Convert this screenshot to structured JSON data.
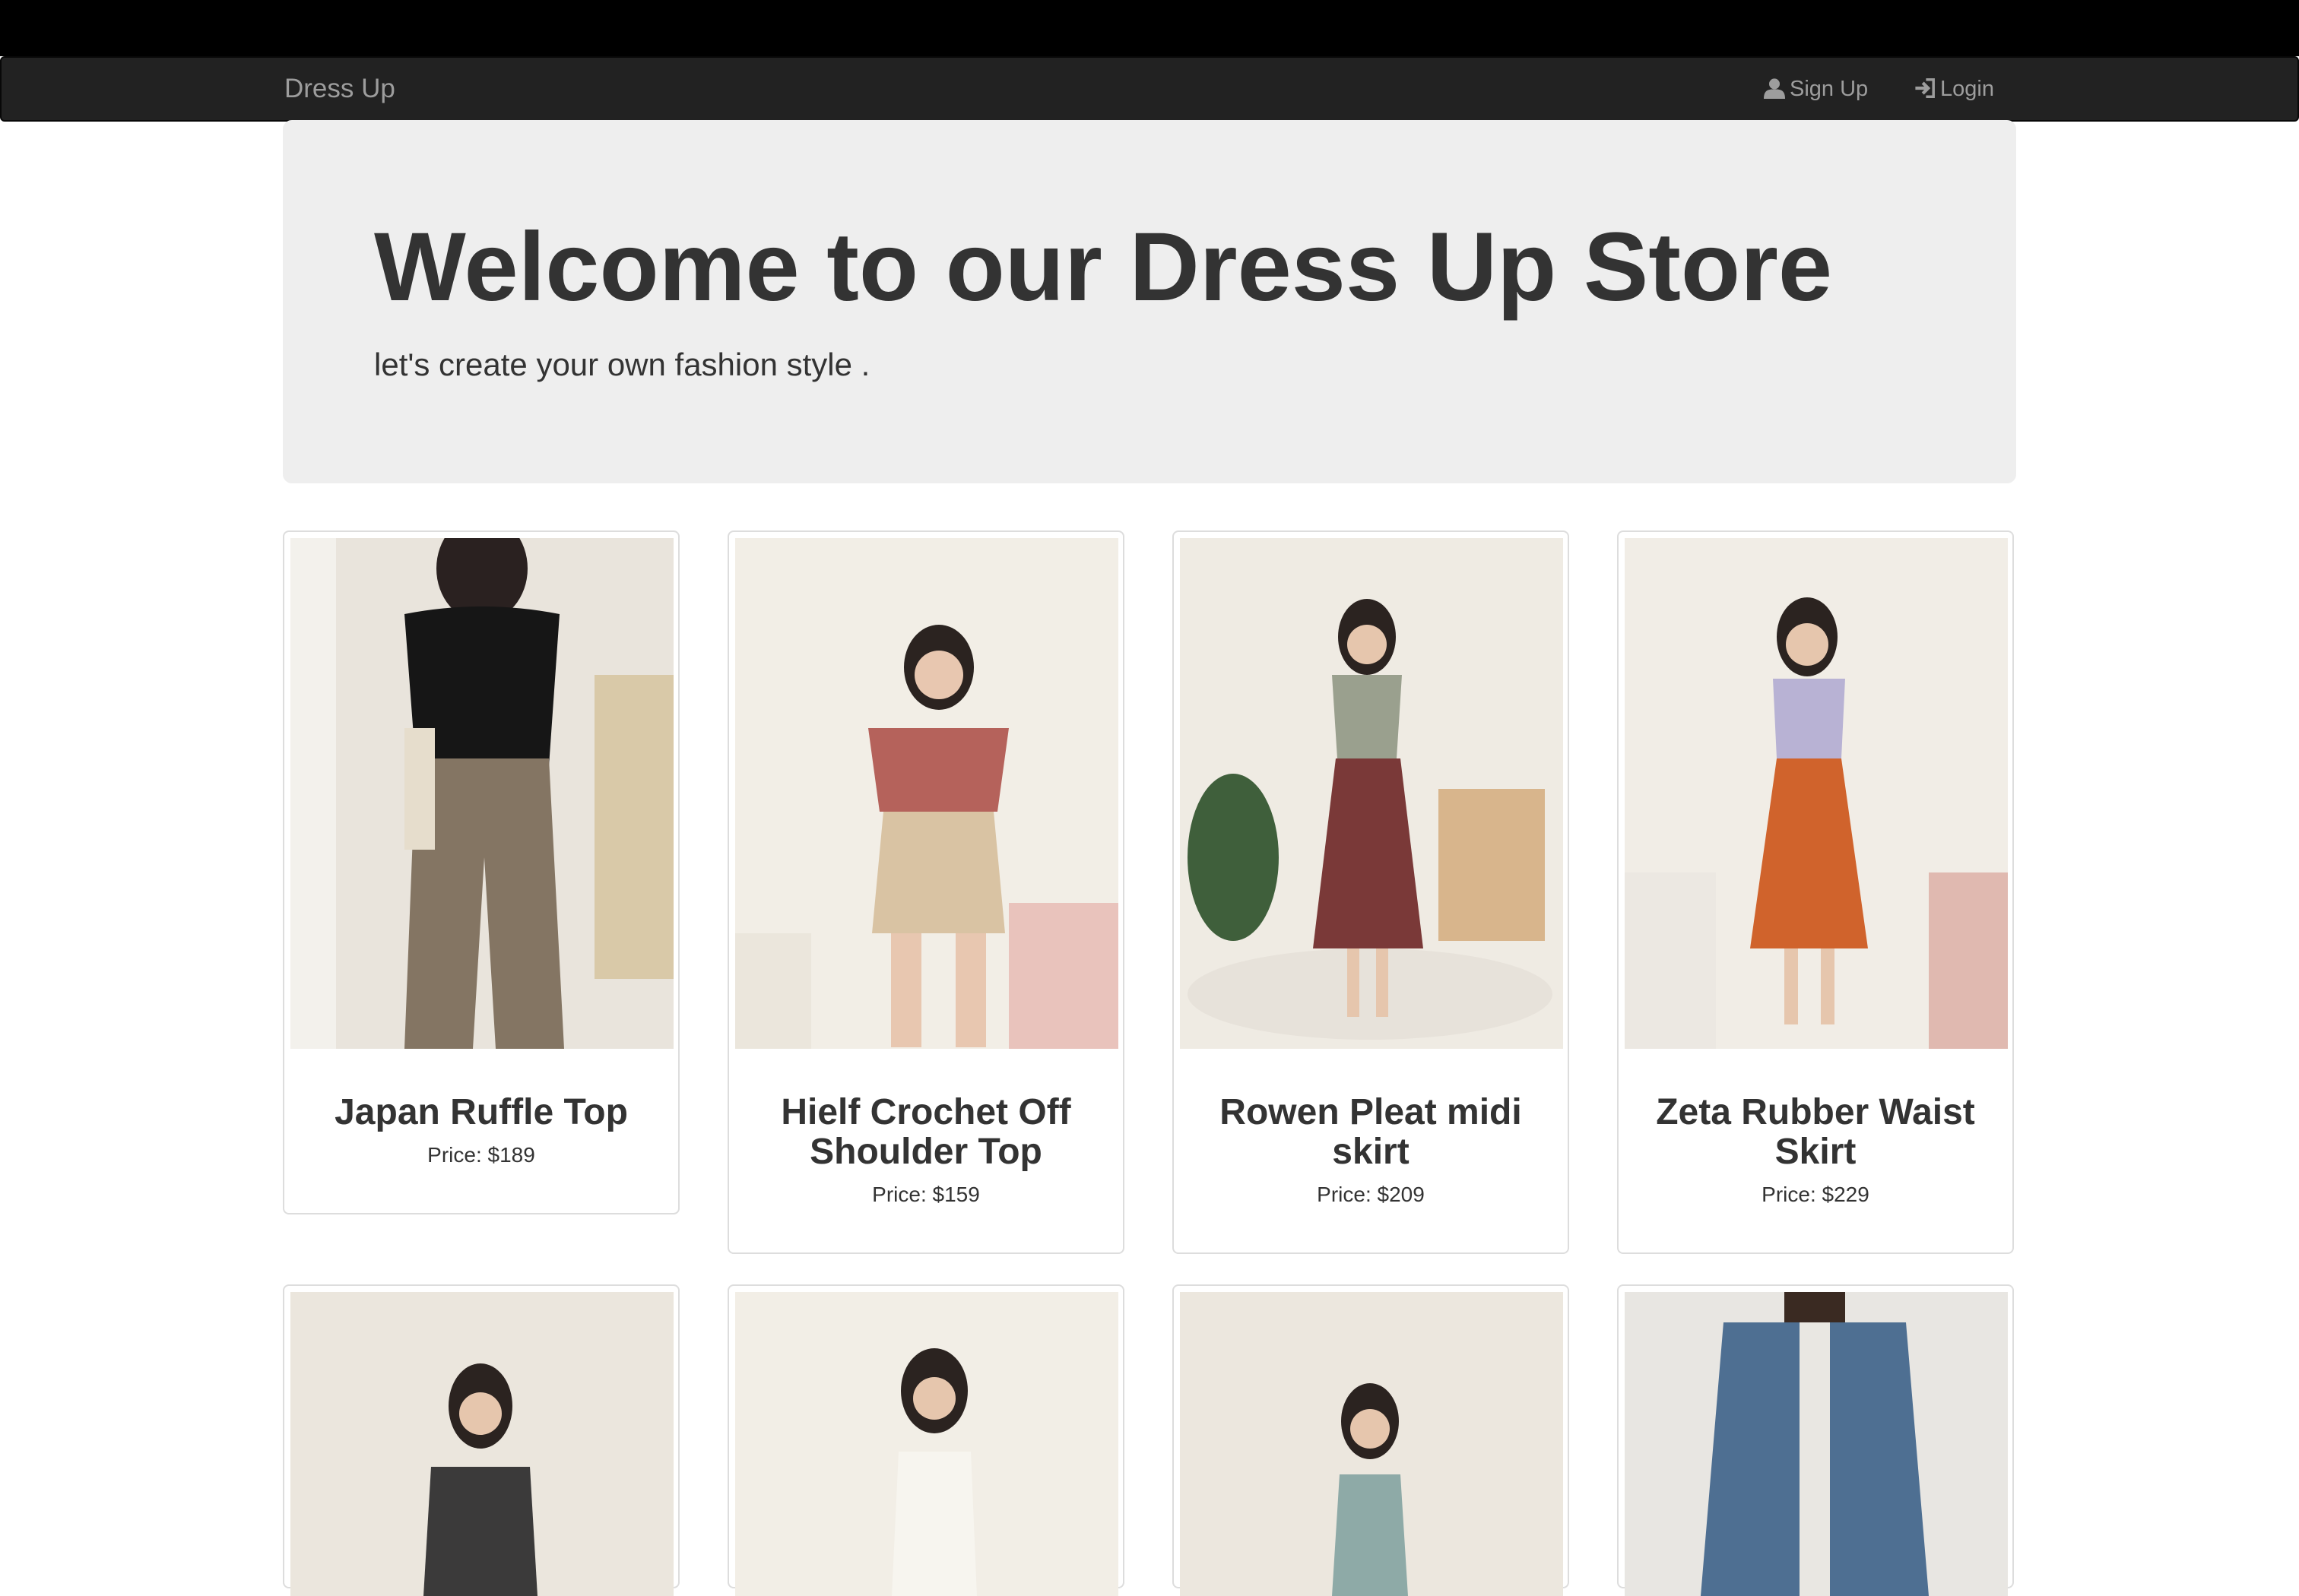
{
  "nav": {
    "brand": "Dress Up",
    "signup_label": "Sign Up",
    "login_label": "Login",
    "signup_icon": "user-icon",
    "login_icon": "log-in-icon"
  },
  "hero": {
    "title": "Welcome to our Dress Up Store",
    "subtitle": "let's create your own fashion style ."
  },
  "products": [
    {
      "name": "Japan Ruffle Top",
      "price": "Price: $189"
    },
    {
      "name": "Hielf Crochet Off Shoulder Top",
      "price": "Price: $159"
    },
    {
      "name": "Rowen Pleat midi skirt",
      "price": "Price: $209"
    },
    {
      "name": "Zeta Rubber Waist Skirt",
      "price": "Price: $229"
    }
  ],
  "colors": {
    "navbar_bg": "#222222",
    "nav_text": "#9d9d9d",
    "hero_bg": "#eeeeee",
    "text": "#333333"
  }
}
